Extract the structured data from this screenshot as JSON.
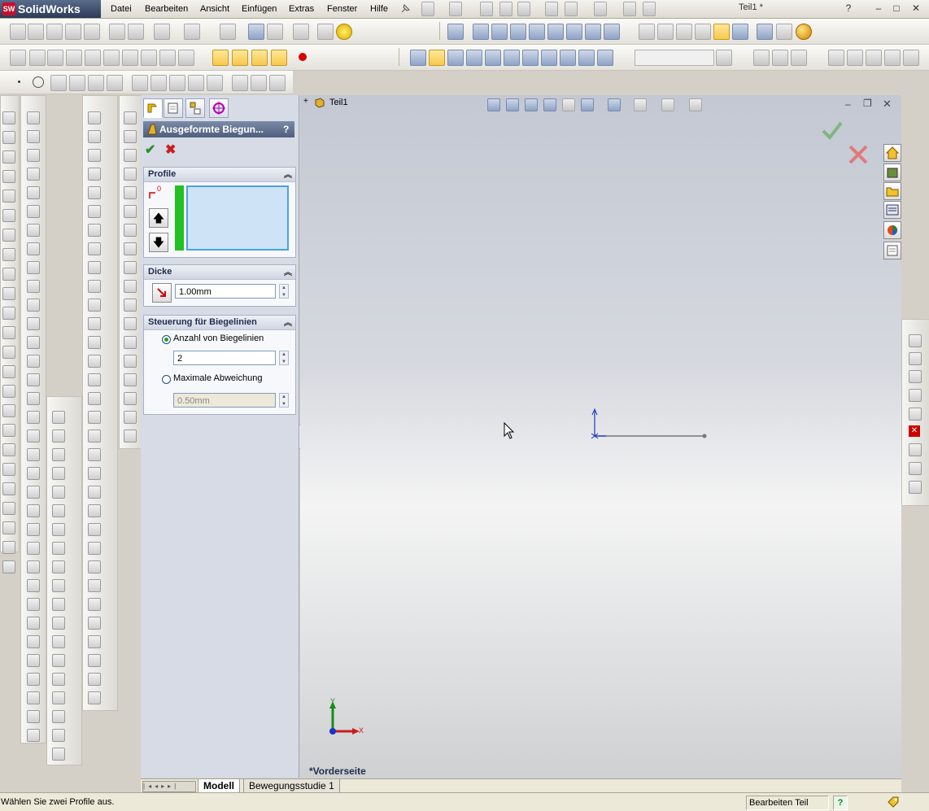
{
  "app": {
    "logo_text": "SolidWorks",
    "logo_badge": "SW",
    "document_title": "Teil1 *"
  },
  "menu": [
    "Datei",
    "Bearbeiten",
    "Ansicht",
    "Einfügen",
    "Extras",
    "Fenster",
    "Hilfe"
  ],
  "window_buttons": {
    "help": "?",
    "minimize": "–",
    "restore": "□",
    "close": "✕"
  },
  "property_manager": {
    "title": "Ausgeformte Biegun...",
    "help": "?",
    "ok_label": "✔",
    "cancel_label": "✖",
    "profile": {
      "header": "Profile",
      "count_badge": "0"
    },
    "thickness": {
      "header": "Dicke",
      "value": "1.00mm"
    },
    "bend_control": {
      "header": "Steuerung für Biegelinien",
      "option1_label": "Anzahl von Biegelinien",
      "option1_value": "2",
      "option1_selected": true,
      "option2_label": "Maximale Abweichung",
      "option2_value": "0.50mm",
      "option2_selected": false
    }
  },
  "feature_tree": {
    "root": "Teil1",
    "expander": "+"
  },
  "viewport": {
    "view_label": "*Vorderseite",
    "triad_x": "X",
    "triad_y": "Y"
  },
  "bottom_tabs": [
    "Modell",
    "Bewegungsstudie 1"
  ],
  "status": {
    "message": "Wählen Sie zwei Profile aus.",
    "mode": "Bearbeiten Teil",
    "help": "?"
  },
  "colors": {
    "accent": "#316ac5",
    "ok": "#2e8b2e",
    "cancel": "#c81e1e",
    "sketch_blue": "#1a33c8",
    "selection_green": "#22c022"
  }
}
